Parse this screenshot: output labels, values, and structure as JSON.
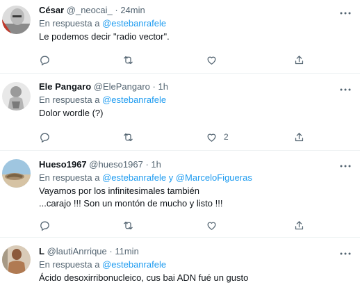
{
  "tweets": [
    {
      "name": "César",
      "handle": "@_neocai_",
      "separator": "·",
      "time": "24min",
      "reply_prefix": "En respuesta a",
      "mentions": [
        "@estebanrafele"
      ],
      "mention_joiner": "",
      "text_lines": [
        "Le podemos decir \"radio vector\"."
      ],
      "like_count": ""
    },
    {
      "name": "Ele Pangaro",
      "handle": "@ElePangaro",
      "separator": "·",
      "time": "1h",
      "reply_prefix": "En respuesta a",
      "mentions": [
        "@estebanrafele"
      ],
      "mention_joiner": "",
      "text_lines": [
        "Dolor wordle (?)"
      ],
      "like_count": "2"
    },
    {
      "name": "Hueso1967",
      "handle": "@hueso1967",
      "separator": "·",
      "time": "1h",
      "reply_prefix": "En respuesta a",
      "mentions": [
        "@estebanrafele",
        "@MarceloFigueras"
      ],
      "mention_joiner": "y",
      "text_lines": [
        "Vayamos por los infinitesimales también",
        "...carajo !!! Son un montón de mucho y listo !!!"
      ],
      "like_count": ""
    },
    {
      "name": "L",
      "handle": "@lautiAnrrique",
      "separator": "·",
      "time": "11min",
      "reply_prefix": "En respuesta a",
      "mentions": [
        "@estebanrafele"
      ],
      "mention_joiner": "",
      "text_lines": [
        "Ácido desoxirribonucleico, cus bai ADN fué un gusto"
      ],
      "like_count": ""
    }
  ],
  "icons": {
    "reply": "reply-icon",
    "retweet": "retweet-icon",
    "like": "like-icon",
    "share": "share-icon",
    "more": "more-options-icon"
  },
  "colors": {
    "link": "#1d9bf0",
    "secondary_text": "#536471",
    "primary_text": "#0f1419",
    "divider": "#eff3f4"
  }
}
